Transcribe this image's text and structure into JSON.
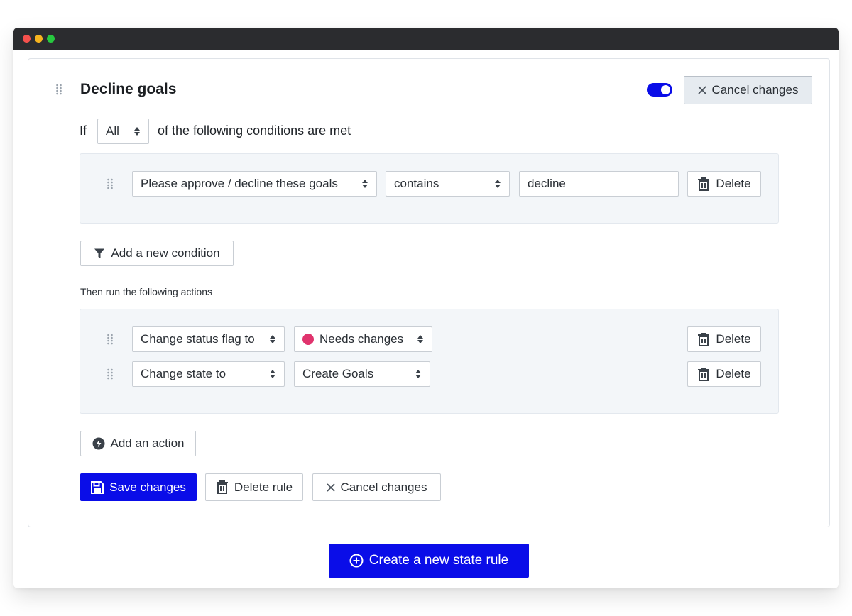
{
  "colors": {
    "accent": "#0a0de8",
    "status_needs_changes": "#e0336d",
    "panel_bg": "#f3f6f9"
  },
  "rule": {
    "title": "Decline goals",
    "enabled": true,
    "cancel_top_label": "Cancel changes"
  },
  "conditions": {
    "if_label": "If",
    "match_select": "All",
    "suffix": "of the following conditions are met",
    "rows": [
      {
        "field": "Please approve / decline these goals",
        "operator": "contains",
        "value": "decline",
        "delete_label": "Delete"
      }
    ],
    "add_label": "Add a new condition"
  },
  "actions": {
    "heading": "Then run the following actions",
    "rows": [
      {
        "action": "Change status flag to",
        "target": "Needs changes",
        "target_icon": "status-dot",
        "delete_label": "Delete"
      },
      {
        "action": "Change state to",
        "target": "Create Goals",
        "delete_label": "Delete"
      }
    ],
    "add_label": "Add an action"
  },
  "footer": {
    "save_label": "Save changes",
    "delete_rule_label": "Delete rule",
    "cancel_label": "Cancel changes"
  },
  "create_label": "Create a new state rule",
  "icons": {
    "drag": "drag-handle-icon",
    "close": "close-icon",
    "trash": "trash-icon",
    "filter": "filter-icon",
    "bolt": "bolt-icon",
    "save": "floppy-disk-icon",
    "plus_circle": "plus-circle-icon",
    "sort": "sort-caret-icon"
  }
}
